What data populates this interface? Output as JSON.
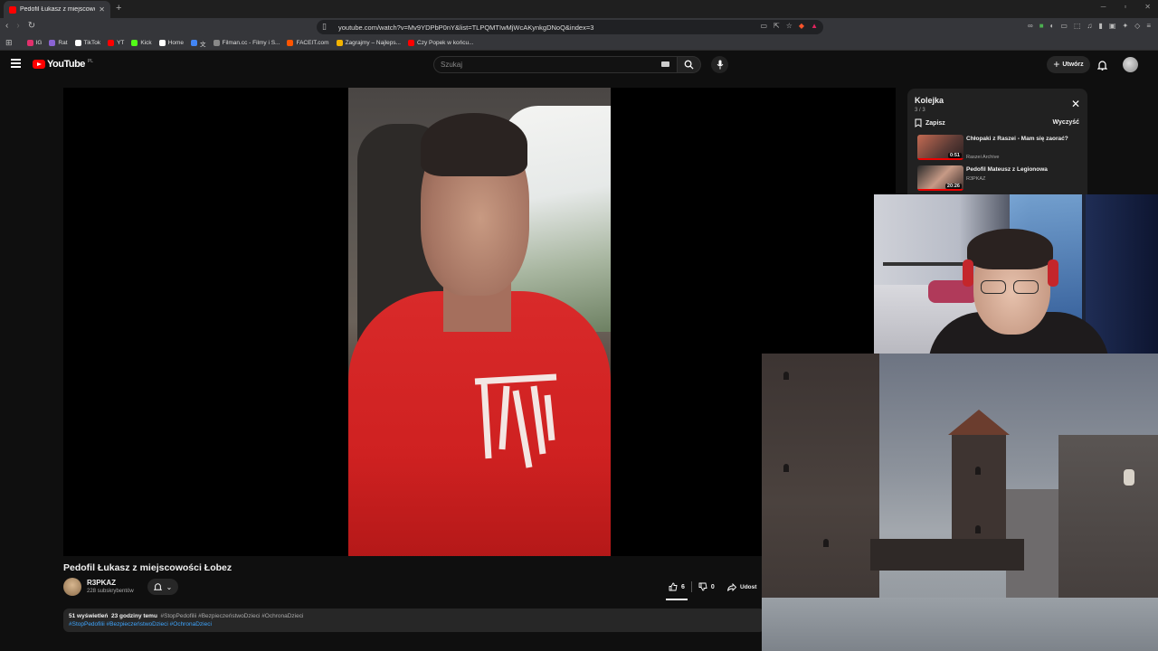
{
  "browser": {
    "tab_title": "Pedofil Łukasz z miejscowości",
    "url": "youtube.com/watch?v=Mv9YDPbP0nY&list=TLPQMTIwMjWcAKynkgDNoQ&index=3",
    "bookmarks": [
      {
        "label": "IG",
        "icon": "instagram-icon",
        "color": "#e1306c"
      },
      {
        "label": "Rat",
        "icon": "bookmark-icon",
        "color": "#8a63d2"
      },
      {
        "label": "TikTok",
        "icon": "tiktok-icon",
        "color": "#ffffff"
      },
      {
        "label": "YT",
        "icon": "youtube-icon",
        "color": "#ff0000"
      },
      {
        "label": "Kick",
        "icon": "kick-icon",
        "color": "#53fc18"
      },
      {
        "label": "Home",
        "icon": "x-icon",
        "color": "#ffffff"
      },
      {
        "label": "文",
        "icon": "translate-icon",
        "color": "#4285f4"
      },
      {
        "label": "Filman.cc - Filmy i S...",
        "icon": "globe-icon",
        "color": "#888888"
      },
      {
        "label": "FACEIT.com",
        "icon": "faceit-icon",
        "color": "#ff5500"
      },
      {
        "label": "Zagrajmy – Najleps...",
        "icon": "user-icon",
        "color": "#f4b400"
      },
      {
        "label": "Czy Popek w końcu...",
        "icon": "youtube-icon",
        "color": "#ff0000"
      }
    ]
  },
  "yt": {
    "logo": "YouTube",
    "region": "PL",
    "search_placeholder": "Szukaj",
    "create_label": "Utwórz"
  },
  "video": {
    "title": "Pedofil Łukasz z miejscowości Łobez",
    "channel": "R3PKAZ",
    "subscribers": "228 subskrybentów",
    "likes": "6",
    "dislikes": "0",
    "share_label": "Udost",
    "views": "51 wyświetleń",
    "age": "23 godziny temu",
    "tags_line": "#StopPedofilii #BezpieczeństwoDzieci #OchronaDzieci",
    "tags_links": "#StopPedofilii #BezpieczeństwoDzieci #OchronaDzieci"
  },
  "queue": {
    "title": "Kolejka",
    "count": "3 / 3",
    "save_label": "Zapisz",
    "clear_label": "Wyczyść",
    "items": [
      {
        "title": "Chłopaki z Raszei - Mam się zaorać?",
        "channel": "Raszei Archive",
        "duration": "0:51"
      },
      {
        "title": "Pedofil Mateusz z Legionowa",
        "channel": "R3PKAZ",
        "duration": "20:26"
      }
    ]
  },
  "colors": {
    "brand": "#ff0000",
    "background": "#0f0f0f",
    "link": "#3ea6ff"
  }
}
